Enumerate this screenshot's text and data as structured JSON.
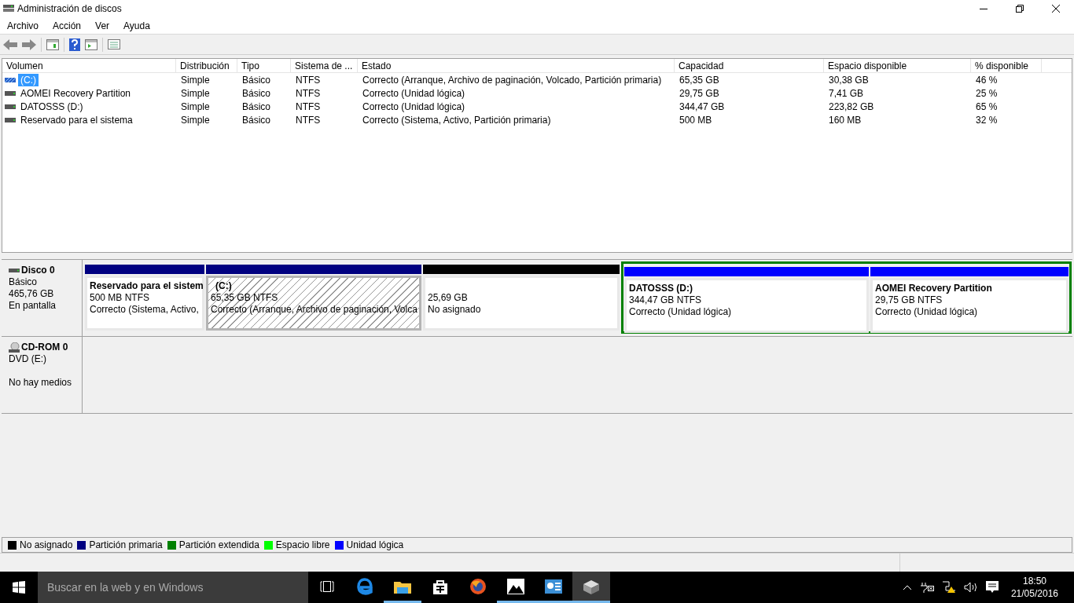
{
  "window": {
    "title": "Administración de discos"
  },
  "menu": [
    "Archivo",
    "Acción",
    "Ver",
    "Ayuda"
  ],
  "volume_list": {
    "columns": [
      "Volumen",
      "Distribución",
      "Tipo",
      "Sistema de ...",
      "Estado",
      "Capacidad",
      "Espacio disponible",
      "% disponible"
    ],
    "rows": [
      {
        "kind": "primary",
        "selected": true,
        "cells": [
          "(C:)",
          "Simple",
          "Básico",
          "NTFS",
          "Correcto (Arranque, Archivo de paginación, Volcado, Partición primaria)",
          "65,35 GB",
          "30,38 GB",
          "46 %"
        ]
      },
      {
        "kind": "drive",
        "selected": false,
        "cells": [
          "AOMEI Recovery Partition",
          "Simple",
          "Básico",
          "NTFS",
          "Correcto (Unidad lógica)",
          "29,75 GB",
          "7,41 GB",
          "25 %"
        ]
      },
      {
        "kind": "drive",
        "selected": false,
        "cells": [
          "DATOSSS (D:)",
          "Simple",
          "Básico",
          "NTFS",
          "Correcto (Unidad lógica)",
          "344,47 GB",
          "223,82 GB",
          "65 %"
        ]
      },
      {
        "kind": "drive",
        "selected": false,
        "cells": [
          "Reservado para el sistema",
          "Simple",
          "Básico",
          "NTFS",
          "Correcto (Sistema, Activo, Partición primaria)",
          "500 MB",
          "160 MB",
          "32 %"
        ]
      }
    ]
  },
  "disks": [
    {
      "kind": "disk",
      "name": "Disco 0",
      "lines": [
        "Básico",
        "465,76 GB",
        "En pantalla"
      ],
      "partitions": [
        {
          "kind": "primary",
          "color": "#000080",
          "selected": false,
          "name": "Reservado para el sistem",
          "size": "500 MB NTFS",
          "status": "Correcto (Sistema, Activo,"
        },
        {
          "kind": "primary",
          "color": "#000080",
          "selected": true,
          "name": "(C:)",
          "size": "65,35 GB NTFS",
          "status": "Correcto (Arranque, Archivo de paginación, Volca"
        },
        {
          "kind": "unallocated",
          "color": "#000000",
          "selected": false,
          "size": "25,69 GB",
          "status": "No asignado"
        },
        {
          "kind": "extended",
          "color": "#008000",
          "children": [
            {
              "kind": "logical",
              "color": "#0000ff",
              "selected": false,
              "name": "DATOSSS  (D:)",
              "size": "344,47 GB NTFS",
              "status": "Correcto (Unidad lógica)"
            },
            {
              "kind": "logical",
              "color": "#0000ff",
              "selected": false,
              "name": "AOMEI Recovery Partition",
              "size": "29,75 GB NTFS",
              "status": "Correcto (Unidad lógica)"
            }
          ]
        }
      ]
    },
    {
      "kind": "cdrom",
      "name": "CD-ROM 0",
      "lines": [
        "DVD (E:)",
        "No hay medios"
      ]
    }
  ],
  "legend": [
    {
      "label": "No asignado",
      "color": "#000000"
    },
    {
      "label": "Partición primaria",
      "color": "#000080"
    },
    {
      "label": "Partición extendida",
      "color": "#008000"
    },
    {
      "label": "Espacio libre",
      "color": "#00ff00"
    },
    {
      "label": "Unidad lógica",
      "color": "#0000ff"
    }
  ],
  "taskbar": {
    "search": {
      "placeholder": "Buscar en la web y en Windows"
    },
    "apps": [
      {
        "kind": "taskview",
        "running": false,
        "selected": false
      },
      {
        "kind": "edge",
        "running": false,
        "selected": false
      },
      {
        "kind": "explorer",
        "running": true,
        "selected": false
      },
      {
        "kind": "store",
        "running": false,
        "selected": false
      },
      {
        "kind": "firefox",
        "running": false,
        "selected": false
      },
      {
        "kind": "photos",
        "running": true,
        "selected": false
      },
      {
        "kind": "control",
        "running": true,
        "selected": false
      },
      {
        "kind": "diskmgmt",
        "running": true,
        "selected": true
      }
    ],
    "time": "18:50",
    "date": "21/05/2016"
  }
}
